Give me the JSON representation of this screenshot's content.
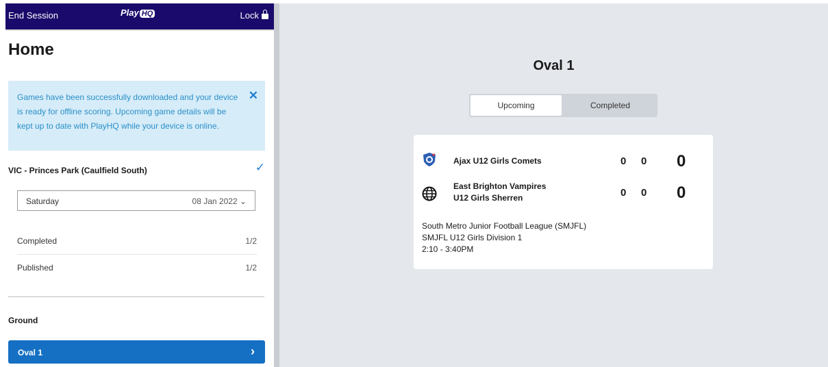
{
  "topbar": {
    "end_session": "End Session",
    "logo": "Play",
    "logo_hq": "HQ",
    "lock": "Lock"
  },
  "sidebar": {
    "title": "Home",
    "alert": {
      "message": "Games have been successfully downloaded and your device is ready for offline scoring. Upcoming game details will be kept up to date with PlayHQ while your device is online."
    },
    "venue": "VIC - Princes Park (Caulfield South)",
    "date_select": {
      "day": "Saturday",
      "date": "08 Jan 2022"
    },
    "stats": [
      {
        "label": "Completed",
        "value": "1/2"
      },
      {
        "label": "Published",
        "value": "1/2"
      }
    ],
    "ground_label": "Ground",
    "ground_button": "Oval 1"
  },
  "main": {
    "title": "Oval 1",
    "tabs": [
      {
        "label": "Upcoming",
        "active": true
      },
      {
        "label": "Completed",
        "active": false
      }
    ],
    "game": {
      "teams": [
        {
          "name": "Ajax U12 Girls Comets",
          "goals": "0",
          "behinds": "0",
          "total": "0",
          "icon": "club-crest-icon"
        },
        {
          "name_line1": "East Brighton Vampires",
          "name_line2": "U12 Girls Sherren",
          "goals": "0",
          "behinds": "0",
          "total": "0",
          "icon": "globe-icon"
        }
      ],
      "league": "South Metro Junior Football League (SMJFL)",
      "division": "SMJFL U12 Girls Division 1",
      "time": "2:10 - 3:40PM"
    }
  },
  "colors": {
    "topbar": "#1a0a6b",
    "accent": "#1570c4",
    "alert_bg": "#d6ecf8",
    "main_bg": "#e4e7eb"
  }
}
